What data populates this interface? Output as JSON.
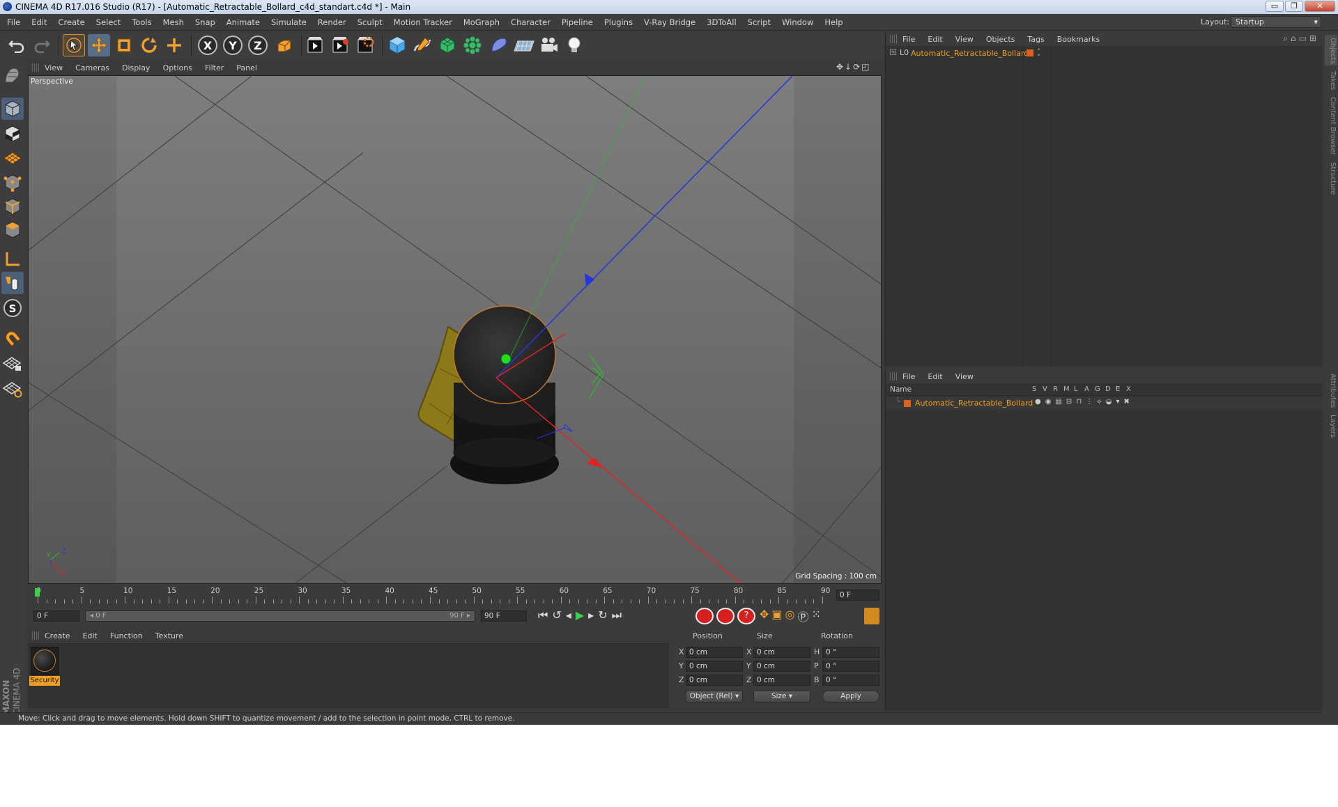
{
  "window": {
    "title": "CINEMA 4D R17.016 Studio (R17) - [Automatic_Retractable_Bollard_c4d_standart.c4d *] - Main",
    "minimize": "▭",
    "maximize": "❐",
    "close": "✕"
  },
  "menubar": {
    "items": [
      "File",
      "Edit",
      "Create",
      "Select",
      "Tools",
      "Mesh",
      "Snap",
      "Animate",
      "Simulate",
      "Render",
      "Sculpt",
      "Motion Tracker",
      "MoGraph",
      "Character",
      "Pipeline",
      "Plugins",
      "V-Ray Bridge",
      "3DToAll",
      "Script",
      "Window",
      "Help"
    ],
    "layout_label": "Layout:",
    "layout_value": "Startup"
  },
  "toolbar": {
    "icons": [
      "undo-icon",
      "redo-icon",
      "select-arrow-icon",
      "move-icon",
      "scale-icon",
      "rotate-icon",
      "live-select-icon",
      "x-axis-icon",
      "y-axis-icon",
      "z-axis-icon",
      "coordinate-system-icon",
      "render-view-icon",
      "render-picture-viewer-icon",
      "render-settings-icon",
      "cube-icon",
      "pen-spline-icon",
      "subdivision-icon",
      "cloner-icon",
      "deformer-icon",
      "floor-icon",
      "camera-icon",
      "light-icon"
    ],
    "x_label": "X",
    "y_label": "Y",
    "z_label": "Z"
  },
  "left_toolbar": {
    "icons": [
      "model-mode-icon",
      "object-mode-icon",
      "texture-mode-icon",
      "workplane-icon",
      "points-mode-icon",
      "edges-mode-icon",
      "polygons-mode-icon",
      "axis-mode-icon",
      "tweak-icon",
      "snap-s-icon",
      "magnet-icon",
      "locked-workplane-icon",
      "planar-workplane-icon"
    ],
    "s_label": "S"
  },
  "viewport": {
    "menu": [
      "View",
      "Cameras",
      "Display",
      "Options",
      "Filter",
      "Panel"
    ],
    "label": "Perspective",
    "grid_spacing": "Grid Spacing : 100 cm",
    "axis_x": "X",
    "axis_y": "Y",
    "axis_z": "Z",
    "colors": {
      "x_axis": "#e02424",
      "y_axis": "#22c422",
      "z_axis": "#2436e0",
      "base_plate": "#8c7a18",
      "bollard": "#222222"
    }
  },
  "timeline": {
    "ticks": [
      "0",
      "5",
      "10",
      "15",
      "20",
      "25",
      "30",
      "35",
      "40",
      "45",
      "50",
      "55",
      "60",
      "65",
      "70",
      "75",
      "80",
      "85",
      "90"
    ],
    "current_frame": "0 F",
    "start_field": "0 F",
    "range_start": "◂ 0 F",
    "range_end": "90 F ▸",
    "end_field": "90 F"
  },
  "material_manager": {
    "menu": [
      "Create",
      "Edit",
      "Function",
      "Texture"
    ],
    "materials": [
      {
        "name": "Security"
      }
    ]
  },
  "coordinates": {
    "headers": {
      "position": "Position",
      "size": "Size",
      "rotation": "Rotation"
    },
    "rows": [
      {
        "axis": "X",
        "pos": "0 cm",
        "size_axis": "X",
        "size": "0 cm",
        "rot_axis": "H",
        "rot": "0 °"
      },
      {
        "axis": "Y",
        "pos": "0 cm",
        "size_axis": "Y",
        "size": "0 cm",
        "rot_axis": "P",
        "rot": "0 °"
      },
      {
        "axis": "Z",
        "pos": "0 cm",
        "size_axis": "Z",
        "size": "0 cm",
        "rot_axis": "B",
        "rot": "0 °"
      }
    ],
    "mode_dropdown": "Object (Rel)",
    "size_dropdown": "Size",
    "apply": "Apply"
  },
  "object_manager": {
    "menu": [
      "File",
      "Edit",
      "View",
      "Objects",
      "Tags",
      "Bookmarks"
    ],
    "objects": [
      {
        "name": "Automatic_Retractable_Bollard"
      }
    ]
  },
  "layer_manager": {
    "menu": [
      "File",
      "Edit",
      "View"
    ],
    "columns": {
      "name": "Name",
      "flags": [
        "S",
        "V",
        "R",
        "M",
        "L",
        "A",
        "G",
        "D",
        "E",
        "X"
      ]
    },
    "layers": [
      {
        "name": "Automatic_Retractable_Bollard"
      }
    ]
  },
  "side_tabs": {
    "top": [
      "Objects",
      "Takes",
      "Content Browser",
      "Structure"
    ],
    "bottom": [
      "Attributes",
      "Layers"
    ]
  },
  "brand": {
    "maxon": "MAXON",
    "cinema": "CINEMA 4D"
  },
  "status": {
    "message": "Move: Click and drag to move elements. Hold down SHIFT to quantize movement / add to the selection in point mode, CTRL to remove."
  }
}
